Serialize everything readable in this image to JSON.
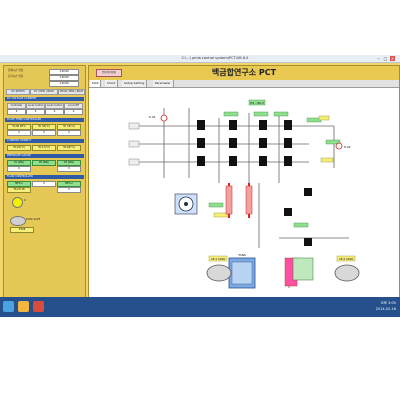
{
  "window": {
    "title": "C:\\...\\ pmla control system\\PCT\\VB 6.0"
  },
  "left": {
    "info_rows": [
      {
        "label": "현재시간 설정",
        "value": "1:00:00"
      },
      {
        "label": "운전시간 설정",
        "value": "1:00:00"
      },
      {
        "label": "",
        "value": "1:00:00"
      }
    ],
    "tabs_row": [
      "DC STATUS",
      "PC / MHA / BACK",
      "CHAN / MHA / BACK"
    ],
    "section1_title": "DC VOLTAGE CURRENT",
    "section1_buttons": [
      "Controller",
      "Local Control",
      "Local Control",
      "Local Off"
    ],
    "section1_values": [
      "0",
      "0",
      "0",
      "0"
    ],
    "section2_title": "PLATE TEMP CONTROLLER",
    "section2_row1": [
      "TC-SP 28°C",
      "TC 32(°C)",
      "TC 33(°C)"
    ],
    "section2_row2": [
      "0",
      "0",
      "0"
    ],
    "section3_title": "CURRENT DENSITY",
    "section3_row": [
      "TC-16(°C)",
      "TC-17(°C)",
      "TC-18(°C)"
    ],
    "section4_title": "PRESSURE GAUGE",
    "section4_row": [
      "P1 (kPa)",
      "P2 (kPa)",
      "P3 (kPa)"
    ],
    "section4_vals": [
      "0",
      "0"
    ],
    "section5_title": "FLOW CONTROLLER",
    "section5_row": [
      "MFC-1",
      "0",
      "MFC-2"
    ],
    "section5_vals": [
      "TC-CH 18",
      "0"
    ],
    "knob_label": "0",
    "bottom_btn1": "DATA SAVE",
    "bottom_btn2": "STOP"
  },
  "main": {
    "header_button": "운전/정지변경",
    "header_title": "백금합연구소 PCT",
    "tabs": [
      "MAP",
      "Chart",
      "Setup Setting",
      "Parameter"
    ],
    "pid_labels": {
      "top_tag": "H2 - 80.2",
      "gauge_left": "P-01",
      "gauge_right": "P-02",
      "tags": [
        "V1",
        "V2",
        "V3",
        "V4",
        "V5",
        "V6",
        "V7"
      ],
      "pump_box1": "VP-1 0000",
      "pump_box2": "VP-2 0000",
      "tank_label": "TANK"
    }
  },
  "taskbar": {
    "time": "오후 3:05",
    "date": "2014-02-16"
  },
  "colors": {
    "screen": "#f1d46a",
    "panel": "#e6c856",
    "accent": "#2e5aa8",
    "taskbar": "#25508c"
  }
}
